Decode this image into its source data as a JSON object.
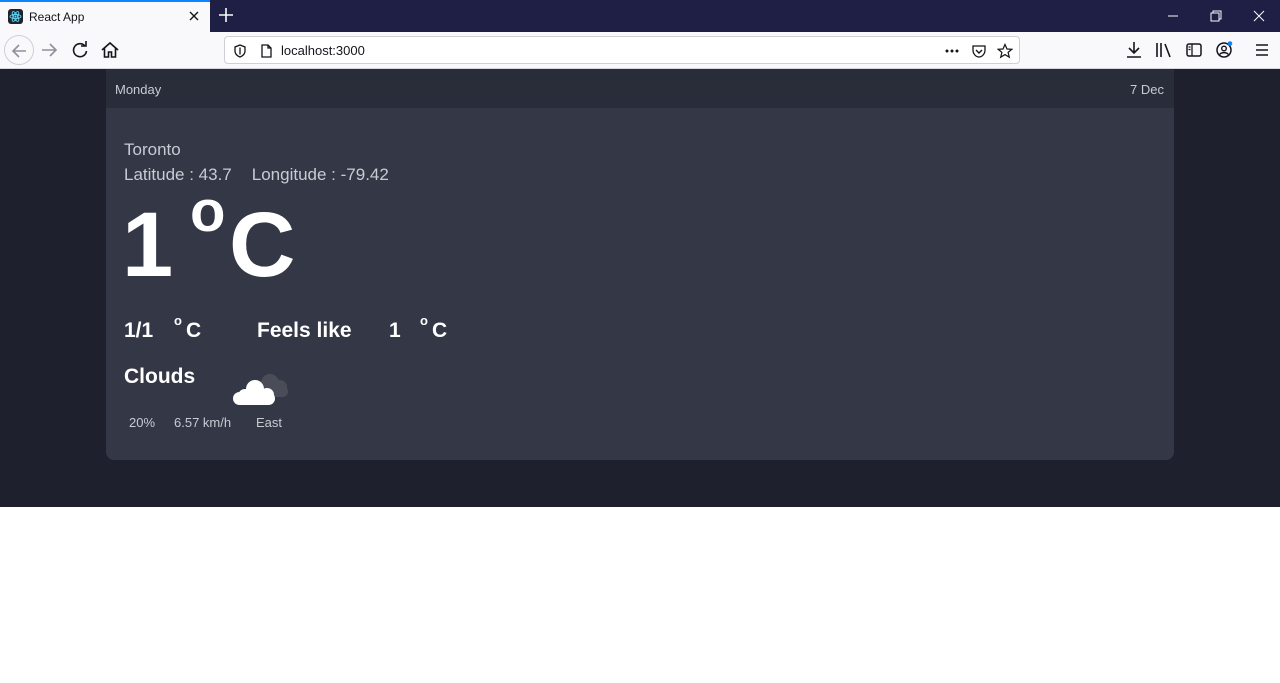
{
  "browser": {
    "tab_title": "React App",
    "url": "localhost:3000"
  },
  "weather": {
    "day": "Monday",
    "date": "7 Dec",
    "city": "Toronto",
    "latitude": "Latitude : 43.7",
    "longitude": "Longitude : -79.42",
    "temp": "1",
    "degree_symbol": "o",
    "unit": "C",
    "min_max": "1/1",
    "feels_like_label": "Feels like",
    "feels_like": "1",
    "condition": "Clouds",
    "condition_icon": "cloud-icon",
    "humidity": "20%",
    "wind_speed": "6.57 km/h",
    "wind_direction": "East"
  },
  "colors": {
    "page_background": "#1f202d",
    "card_background": "#333746",
    "card_header": "#292c39",
    "accent": "#0a84ff"
  }
}
